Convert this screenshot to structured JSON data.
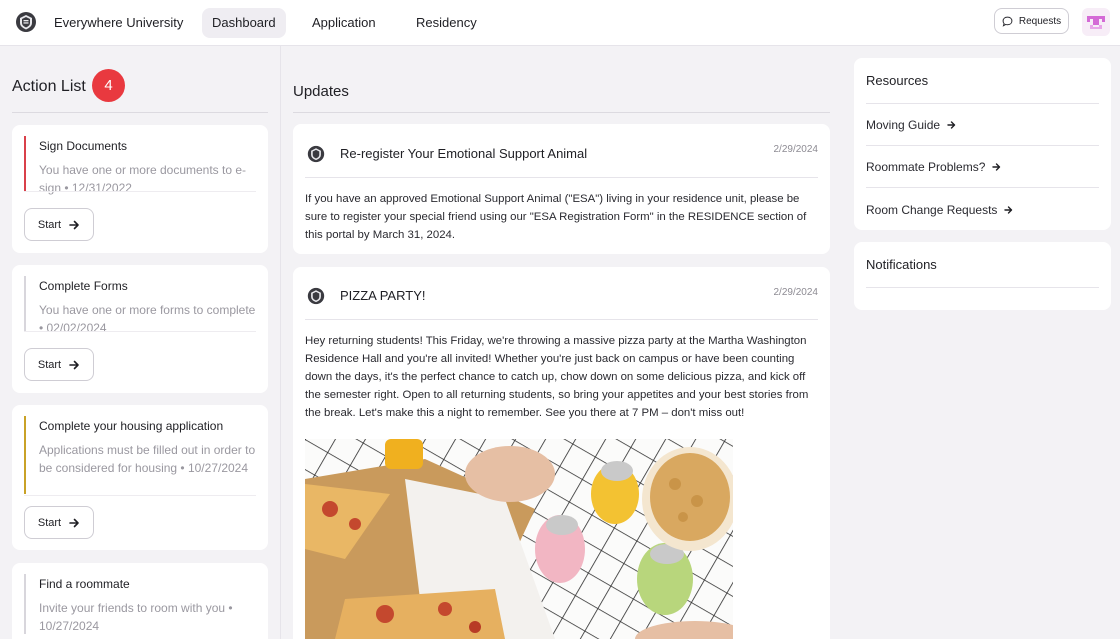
{
  "header": {
    "brand": "Everywhere University",
    "nav": [
      {
        "label": "Dashboard",
        "active": true
      },
      {
        "label": "Application",
        "active": false
      },
      {
        "label": "Residency",
        "active": false
      }
    ],
    "requests_label": "Requests"
  },
  "action_list": {
    "title": "Action List",
    "count": "4",
    "items": [
      {
        "title": "Sign Documents",
        "description": "You have one or more documents to e-sign • 12/31/2022",
        "button": "Start",
        "accent": "#d9404a"
      },
      {
        "title": "Complete Forms",
        "description": "You have one or more forms to complete • 02/02/2024",
        "button": "Start",
        "accent": "#d8d6dc"
      },
      {
        "title": "Complete your housing application",
        "description": "Applications must be filled out in order to be considered for housing • 10/27/2024",
        "button": "Start",
        "accent": "#c9a227"
      },
      {
        "title": "Find a roommate",
        "description": "Invite your friends to room with you • 10/27/2024",
        "accent": "#d8d6dc"
      }
    ]
  },
  "updates": {
    "title": "Updates",
    "posts": [
      {
        "title": "Re-register Your Emotional Support Animal",
        "date": "2/29/2024",
        "body": "If you have an approved Emotional Support Animal (\"ESA\") living in your residence unit, please be sure to register your special friend using our \"ESA Registration Form\" in the RESIDENCE section of this portal by March 31, 2024."
      },
      {
        "title": "PIZZA PARTY!",
        "date": "2/29/2024",
        "body": "Hey returning students! This Friday, we're throwing a massive pizza party at the Martha Washington Residence Hall and you're all invited! Whether you're just back on campus or have been counting down the days, it's the perfect chance to catch up, chow down on some delicious pizza, and kick off the semester right. Open to all returning students, so bring your appetites and your best stories from the break. Let's make this a night to remember. See you there at 7 PM – don't miss out!"
      }
    ]
  },
  "resources": {
    "title": "Resources",
    "links": [
      "Moving Guide",
      "Roommate Problems?",
      "Room Change Requests"
    ]
  },
  "notifications": {
    "title": "Notifications"
  },
  "colors": {
    "badge": "#e9393f",
    "background": "#f3f2f5",
    "card": "#ffffff"
  },
  "icons": {
    "logo": "shield-crest-icon",
    "requests": "chat-bubble-icon",
    "start": "arrow-right-icon",
    "resource_link": "arrow-right-small-icon",
    "avatar": "pixel-avatar-icon"
  }
}
